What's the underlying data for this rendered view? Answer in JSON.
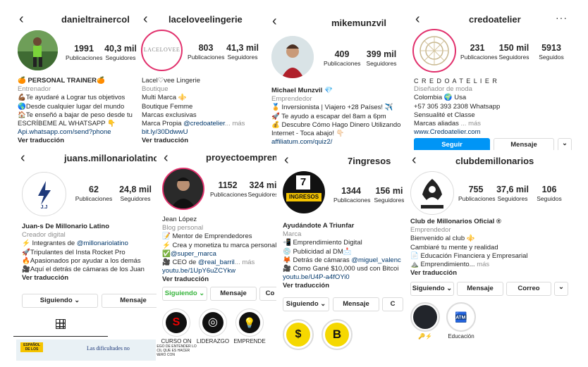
{
  "p1": {
    "username": "danieltrainercol",
    "stats": [
      {
        "n": "1991",
        "l": "Publicaciones"
      },
      {
        "n": "40,3 mil",
        "l": "Seguidores"
      }
    ],
    "bio": {
      "name": "🍊 PERSONAL TRAINER🍊",
      "category": "Entrenador",
      "l1": "💪🏾Te ayudaré a Lograr tus objetivos",
      "l2": "🌎Desde cualquier lugar del mundo",
      "l3": "🏠Te enseñó a bajar de peso desde tu",
      "l4": "ESCRÍBEME AL WHATSAPP 👇",
      "link": "Api.whatsapp.com/send?phone",
      "translate": "Ver traducción"
    }
  },
  "p2": {
    "username": "laceloveelingerie",
    "avatar_text": "LACELOVEE",
    "stats": [
      {
        "n": "803",
        "l": "Publicaciones"
      },
      {
        "n": "41,3 mil",
        "l": "Seguidores"
      }
    ],
    "bio": {
      "name": "Lacel♡vee Lingerie",
      "category": "Boutique",
      "l1": "Multi Marca ⚜️",
      "l2": "Boutique Femme",
      "l3": "Marcas exclusivas",
      "l4a": "Marca Propia ",
      "l4b": "@credoatelier",
      "l4c": "... más",
      "link": "bit.ly/30DdwwU",
      "translate": "Ver traducción"
    }
  },
  "p3": {
    "username": "mikemunzvil",
    "stats": [
      {
        "n": "409",
        "l": "Publicaciones"
      },
      {
        "n": "399 mil",
        "l": "Seguidores"
      }
    ],
    "bio": {
      "name": "Michael Munzvil 💎",
      "category": "Emprendedor",
      "l1": "🏅 Inversionista | Viajero +28 Países! ✈️",
      "l2": "🚀 Te ayudo a escapar del 8am a 6pm",
      "l3": "💰 Descubre Cómo Hago Dinero Utilizando",
      "l4": "Internet - Toca abajo! 👇🏻",
      "link": "affiliatum.com/quiz2/"
    }
  },
  "p4": {
    "username": "credoatelier",
    "stats": [
      {
        "n": "231",
        "l": "Publicaciones"
      },
      {
        "n": "150 mil",
        "l": "Seguidores"
      },
      {
        "n": "5913",
        "l": "Seguidos"
      }
    ],
    "bio": {
      "name": "C R E D O A T E L I E R",
      "category": "Diseñador de moda",
      "l1": "Colombia 🌍 Usa",
      "l2": "+57 305 393 2308 Whatsapp",
      "l3": "Sensualité et Classe",
      "l4a": "Marcas aliadas ",
      "l4b": "... más",
      "link": "www.Credoatelier.com"
    },
    "buttons": {
      "follow": "Seguir",
      "message": "Mensaje",
      "more": "⌄"
    }
  },
  "p5": {
    "username": "juans.millonariolatino",
    "avatar_text": "J.J",
    "stats": [
      {
        "n": "62",
        "l": "Publicaciones"
      },
      {
        "n": "24,8 mil",
        "l": "Seguidores"
      }
    ],
    "bio": {
      "name": "Juan-s De Millonario Latino",
      "category": "Creador digital",
      "l1a": "⚡ Integrantes de ",
      "l1b": "@millonariolatino",
      "l2": "🚀Tripulantes del Insta Rocket Pro",
      "l3": "🔥Apasionados por ayudar a los demás",
      "l4": "🎥Aquí el detrás de cámaras de los Juan",
      "translate": "Ver traducción"
    },
    "buttons": {
      "following": "Siguiendo ⌄",
      "message": "Mensaje"
    },
    "grid_icon": "grid-icon",
    "thumb_text": "Las dificultades no",
    "thumb_badge": "ESPAÑOL DE LOS"
  },
  "p6": {
    "username": "proyectoemprende",
    "stats": [
      {
        "n": "1152",
        "l": "Publicaciones"
      },
      {
        "n": "324 mi",
        "l": "Seguidores"
      }
    ],
    "bio": {
      "name": "Jean López",
      "category": "Blog personal",
      "l1": "📝 Mentor de Emprendedores",
      "l2": "⚡ Crea y monetiza tu marca personal 💰",
      "l3a": "✅",
      "l3b": "@super_marca",
      "l4a": "🎥 CEO de ",
      "l4b": "@real_barril",
      "l4c": "... más",
      "link": "youtu.be/1UpY6uZCYkw",
      "translate": "Ver traducción"
    },
    "buttons": {
      "following": "Siguiendo ⌄",
      "message": "Mensaje",
      "co": "Co"
    },
    "highlights": [
      "CURSO ON",
      "LIDERAZGO",
      "EMPRENDE"
    ],
    "thumb_text": "LUEGO DE ENTENDER LO FÁCIL QUE ES HACER DINERO CON"
  },
  "p7": {
    "username": "7ingresos",
    "avatar_top": "7",
    "avatar_text": "INGRESOS",
    "stats": [
      {
        "n": "1344",
        "l": "Publicaciones"
      },
      {
        "n": "156 mi",
        "l": "Seguidores"
      }
    ],
    "bio": {
      "name": "Ayudándote A Triunfar",
      "category": "Marca",
      "l1": "📲 Emprendimiento Digital",
      "l2": "💿 Publicidad al DM📩",
      "l3a": "🦊 Detrás de cámaras ",
      "l3b": "@miguel_valenc",
      "l4": "🎥 Como Gané $10,000 usd con Bitcoi",
      "link": "youtu.be/U4P-a4fOYi0",
      "translate": "Ver traducción"
    },
    "buttons": {
      "following": "Siguiendo ⌄",
      "message": "Mensaje",
      "co": "C"
    }
  },
  "p8": {
    "username": "clubdemillonarios",
    "stats": [
      {
        "n": "755",
        "l": "Publicaciones"
      },
      {
        "n": "37,6 mil",
        "l": "Seguidores"
      },
      {
        "n": "106",
        "l": "Seguidos"
      }
    ],
    "bio": {
      "name": "Club de Millonarios Oficial ®",
      "category": "Emprendedor",
      "l1": "Bienvenido al club ⚜️",
      "l2": "Cambiaré tu mente y realidad",
      "l3": "📄 Educación Financiera y Empresarial",
      "l4a": "⛰️ Emprendimiento...",
      "l4b": " más",
      "translate": "Ver traducción"
    },
    "buttons": {
      "following": "Siguiendo ⌄",
      "message": "Mensaje",
      "mail": "Correo",
      "more": "⌄"
    },
    "highlights": [
      "🔑⚡",
      "Educación"
    ]
  }
}
